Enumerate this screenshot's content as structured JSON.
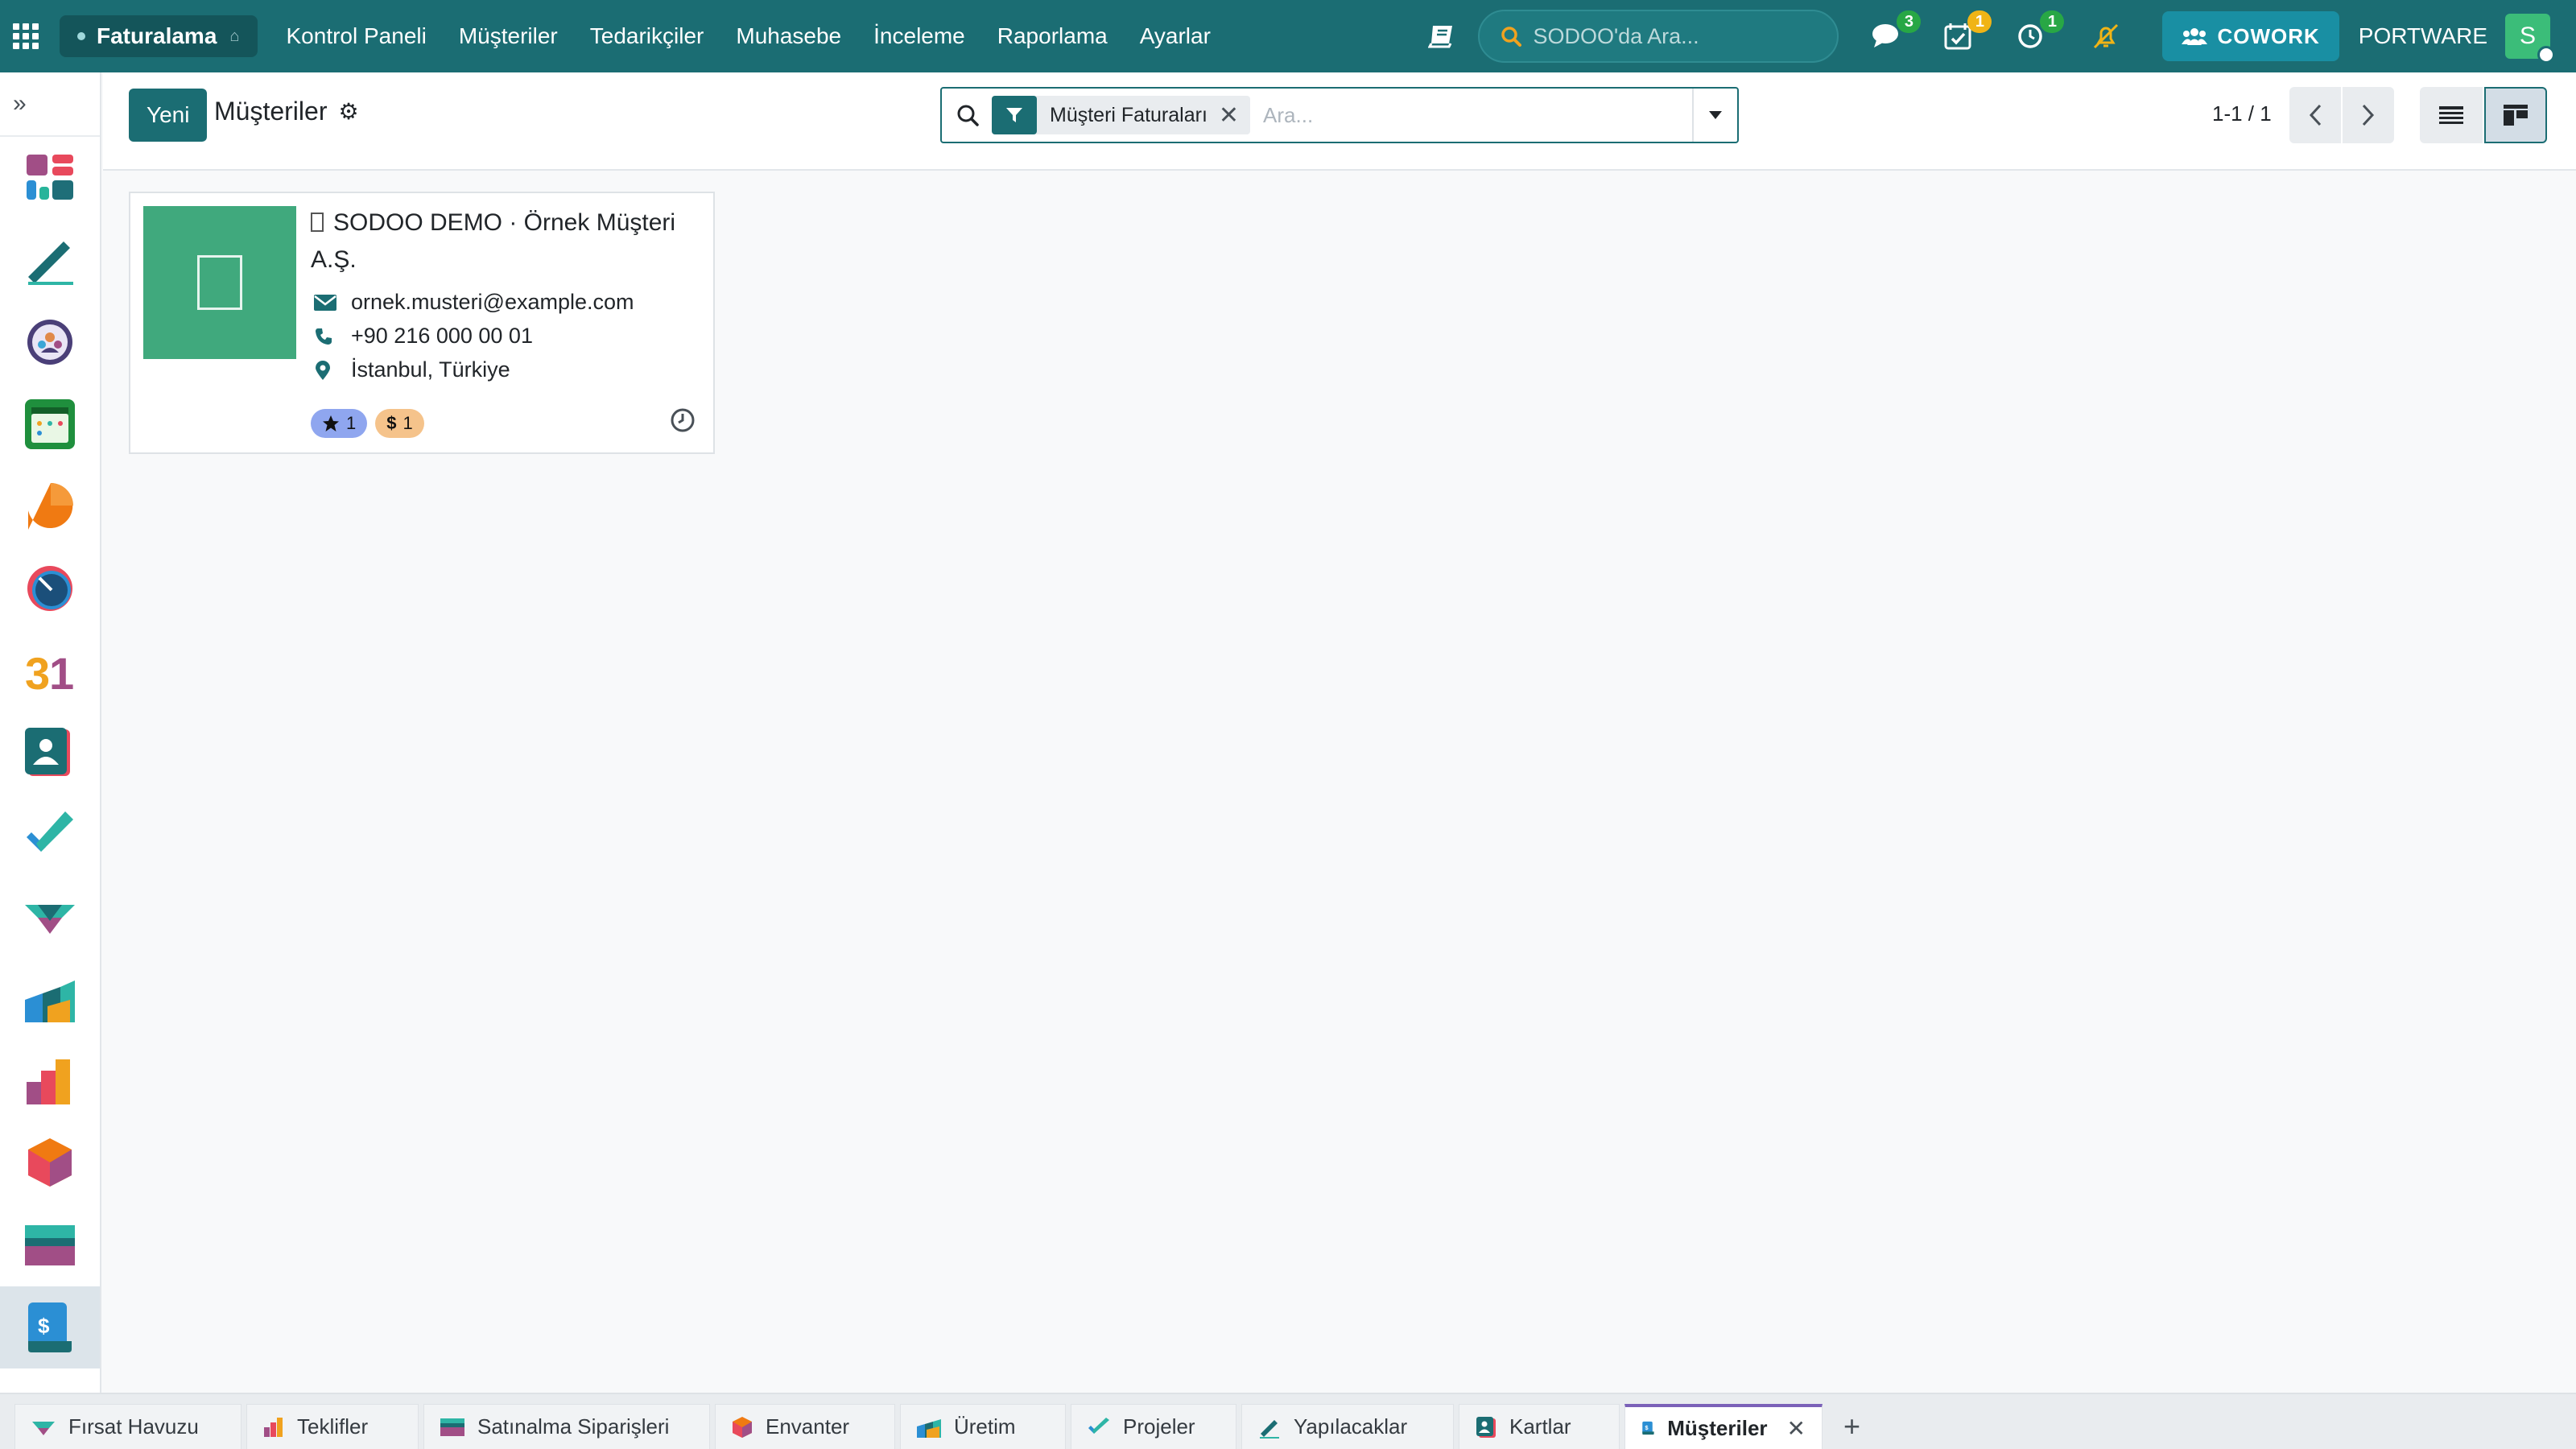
{
  "topbar": {
    "app_name": "Faturalama",
    "menu": [
      "Kontrol Paneli",
      "Müşteriler",
      "Tedarikçiler",
      "Muhasebe",
      "İnceleme",
      "Raporlama",
      "Ayarlar"
    ],
    "search_placeholder": "SODOO'da Ara...",
    "messages_count": "3",
    "activities_count": "1",
    "timer_count": "1",
    "cowork_label": "COWORK",
    "company": "PORTWARE",
    "avatar_initial": "S"
  },
  "sidebar": {
    "toggle": "»",
    "apps": [
      "dashboard-app",
      "notes-app",
      "team-app",
      "calendar-app",
      "discuss-app",
      "dial-app",
      "calendar31-app",
      "contacts-app",
      "tasks-app",
      "crm-app",
      "manufacturing-app",
      "sales-app",
      "inventory-app",
      "purchase-app",
      "invoicing-app"
    ]
  },
  "control_panel": {
    "new_button": "Yeni",
    "title": "Müşteriler",
    "gear": "⚙",
    "filter_facet": "Müşteri Faturaları",
    "search_placeholder": "Ara...",
    "pager": "1-1 / 1"
  },
  "records": [
    {
      "name": "SODOO DEMO · Örnek Müşteri A.Ş.",
      "email": "ornek.musteri@example.com",
      "phone": "+90 216 000 00 01",
      "location": "İstanbul, Türkiye",
      "stars": "1",
      "invoices": "1"
    }
  ],
  "tabs": [
    {
      "label": "Fırsat Havuzu",
      "icon": "crm-icon"
    },
    {
      "label": "Teklifler",
      "icon": "sales-icon"
    },
    {
      "label": "Satınalma Siparişleri",
      "icon": "purchase-icon"
    },
    {
      "label": "Envanter",
      "icon": "inventory-icon"
    },
    {
      "label": "Üretim",
      "icon": "manufacturing-icon"
    },
    {
      "label": "Projeler",
      "icon": "project-icon"
    },
    {
      "label": "Yapılacaklar",
      "icon": "todo-icon"
    },
    {
      "label": "Kartlar",
      "icon": "contacts-icon"
    },
    {
      "label": "Müşteriler",
      "icon": "invoicing-icon",
      "active": true
    }
  ],
  "colors": {
    "primary": "#1b6d73",
    "avatar": "#40a97d",
    "tag_star": "#8fa6ef",
    "tag_dollar": "#f5c38b"
  }
}
